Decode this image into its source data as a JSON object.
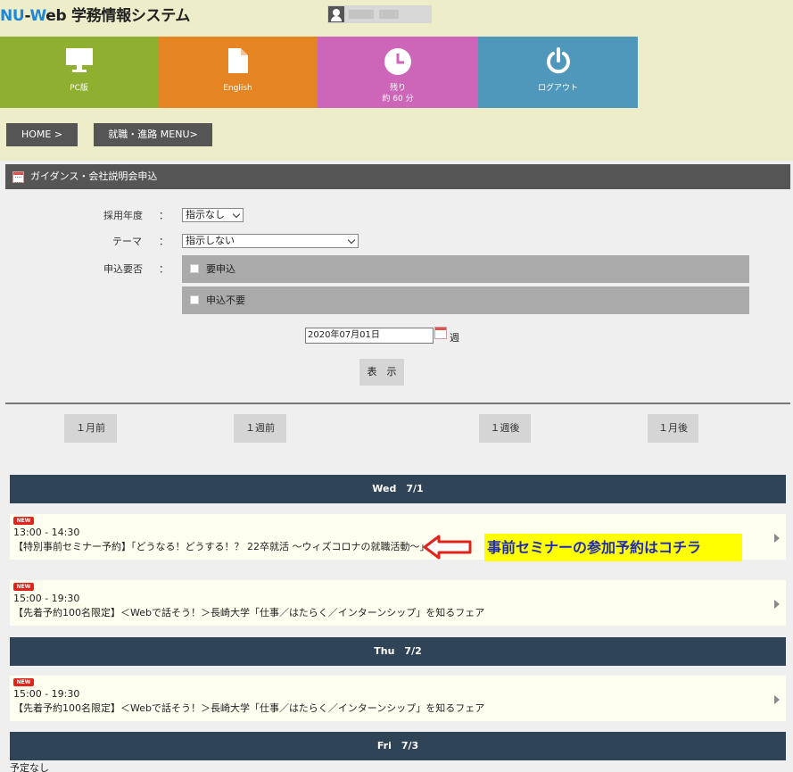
{
  "header": {
    "logo_nu": "NU",
    "logo_dash": "-",
    "logo_w": "W",
    "logo_rest": "eb 学務情報システム",
    "user_icon": "user-icon"
  },
  "tiles": [
    {
      "label": "PC版",
      "icon": "monitor-icon",
      "color": "#8faf30"
    },
    {
      "label": "English",
      "icon": "document-icon",
      "color": "#e58422"
    },
    {
      "label": "残り",
      "label2": "約 60 分",
      "icon": "clock-icon",
      "color": "#cd66b9"
    },
    {
      "label": "ログアウト",
      "icon": "power-icon",
      "color": "#5098bb"
    }
  ],
  "breadcrumb": {
    "home": "HOME >",
    "menu": "就職・進路 MENU>"
  },
  "panel": {
    "title": "ガイダンス・会社説明会申込",
    "year_label": "採用年度",
    "year_sep": "：",
    "year_value": "指示なし",
    "theme_label": "テーマ",
    "theme_sep": "：",
    "theme_value": "指示しない",
    "apply_label": "申込要否",
    "apply_sep": "：",
    "apply_opt1": "要申込",
    "apply_opt2": "申込不要",
    "date_value": "2020年07月01日",
    "week_label": "週",
    "show_button": "表　示"
  },
  "nav": {
    "month_prev": "１月前",
    "week_prev": "１週前",
    "week_next": "１週後",
    "month_next": "１月後"
  },
  "days": [
    {
      "label": "Wed　7/1",
      "events": [
        {
          "badge": "NEW",
          "time": "13:00 - 14:30",
          "title": "【特別事前セミナー予約】「どうなる！どうする！？ 22卒就活 ～ウィズコロナの就職活動～」"
        },
        {
          "badge": "NEW",
          "time": "15:00 - 19:30",
          "title": "【先着予約100名限定】＜Webで話そう！＞長崎大学「仕事／はたらく／インターンシップ」を知るフェア"
        }
      ]
    },
    {
      "label": "Thu　7/2",
      "events": [
        {
          "badge": "NEW",
          "time": "15:00 - 19:30",
          "title": "【先着予約100名限定】＜Webで話そう！＞長崎大学「仕事／はたらく／インターンシップ」を知るフェア"
        }
      ]
    },
    {
      "label": "Fri　7/3",
      "empty_text": "予定なし"
    }
  ],
  "annotation": {
    "text": "事前セミナーの参加予約はコチラ",
    "highlight_color": "#ffff00",
    "arrow_color": "#e2231a"
  }
}
